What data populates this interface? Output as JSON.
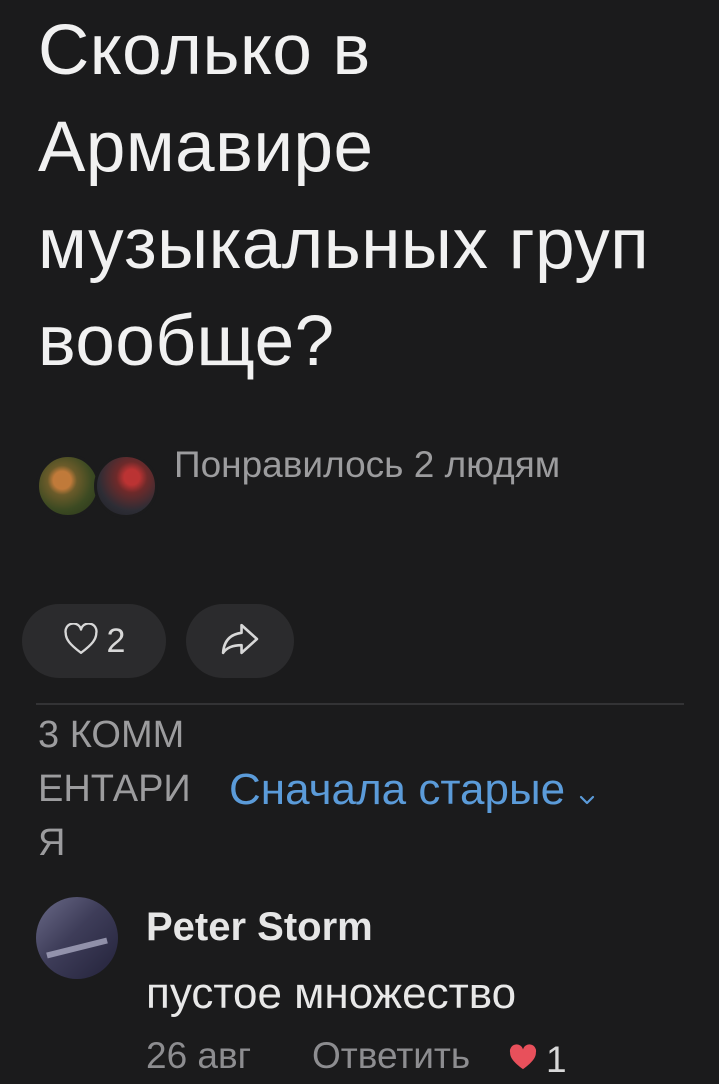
{
  "post": {
    "title": "Сколько в Армавире музыкальных груп вообще?"
  },
  "likes": {
    "text": "Понравилось 2 людям"
  },
  "actions": {
    "like_count": "2"
  },
  "comments": {
    "count_label": "3 КОММЕНТАРИЯ",
    "sort_label": "Сначала старые",
    "items": [
      {
        "author": "Peter Storm",
        "text": "пустое множество",
        "date": "26 авг",
        "reply_label": "Ответить",
        "likes": "1"
      }
    ]
  },
  "colors": {
    "background": "#1b1b1c",
    "accent": "#5b9bd9",
    "heart": "#e8505b"
  }
}
